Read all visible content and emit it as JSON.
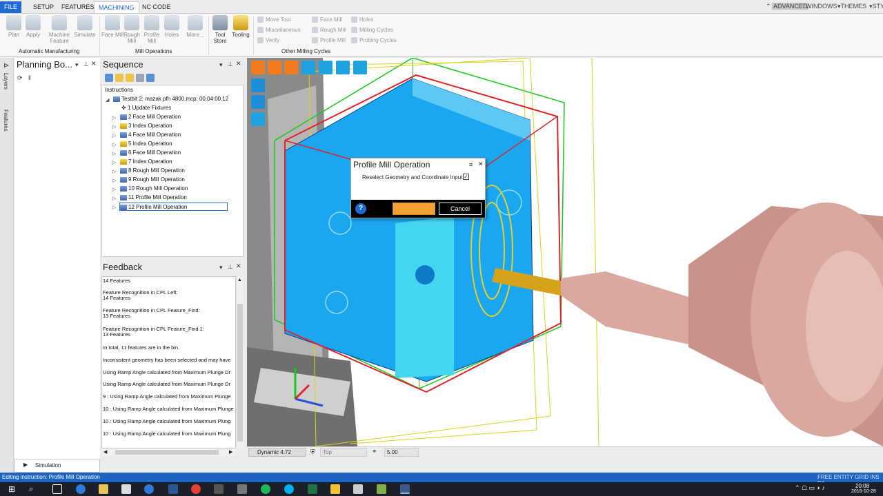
{
  "tabs": [
    "FILE",
    "SETUP",
    "FEATURES",
    "MACHINING",
    "NC CODE"
  ],
  "active_tab": "MACHINING",
  "right_tabs": [
    "ADVANCED",
    "WINDOWS",
    "THEMES",
    "STYL"
  ],
  "ribbon": {
    "buttons": [
      {
        "label": "Plan"
      },
      {
        "label": "Apply"
      },
      {
        "label": "Machine Feature"
      },
      {
        "label": "Simulate"
      },
      {
        "label": "Face Mill"
      },
      {
        "label": "Rough Mill"
      },
      {
        "label": "Profile Mill"
      },
      {
        "label": "Holes"
      },
      {
        "label": "More..."
      },
      {
        "label": "Tool Store"
      },
      {
        "label": "Tooling"
      }
    ],
    "small_col1": [
      "Move Tool",
      "Miscellaneous",
      "Verify"
    ],
    "small_col2": [
      "Face Mill",
      "Rough Mill",
      "Profile Mill"
    ],
    "small_col3": [
      "Holes",
      "Milling Cycles",
      "Probing Cycles"
    ],
    "groups": [
      "Automatic Manufacturing",
      "Mill Operations",
      "Other Milling Cycles"
    ]
  },
  "left_strip": [
    "Layers",
    "Features"
  ],
  "planning_panel": {
    "title": "Planning Bo..."
  },
  "sequence_panel": {
    "title": "Sequence",
    "header": "Instructions",
    "root": "Testbit 2: mazak pfh 4800.mcp: 00:04:00.12",
    "items": [
      "1 Update Fixtures",
      "2 Face Mill Operation",
      "3 Index Operation",
      "4 Face Mill Operation",
      "5 Index Operation",
      "6 Face Mill Operation",
      "7 Index Operation",
      "8 Rough Mill Operation",
      "9 Rough Mill Operation",
      "10 Rough Mill Operation",
      "11 Profile Mill Operation",
      "12 Profile Mill Operation"
    ],
    "selected": "12 Profile Mill Operation"
  },
  "feedback_panel": {
    "title": "Feedback",
    "lines": [
      "14 Features",
      "Feature Recognition in CPL Left:",
      " 14 Features",
      "Feature Recognition in CPL Feature_Find:",
      " 13 Features",
      "Feature Recognition in CPL Feature_Find.1:",
      " 13 Features",
      "In total,  11 features are in the bin.",
      "Inconsistent geometry has been selected and may have",
      "Using Ramp Angle calculated from Maximum Plunge Dr",
      "Using Ramp Angle calculated from Maximum Plunge Dr",
      "9 : Using Ramp Angle calculated from Maximum Plunge",
      "10 : Using Ramp Angle calculated from Maximum Plunge",
      "10 : Using Ramp Angle calculated from Maximum Plung",
      "10 : Using Ramp Angle calculated from Maximum Plung"
    ]
  },
  "simulation_label": "Simulation",
  "dialog": {
    "title": "Profile Mill Operation",
    "checkbox_label": "Reselect Geometry and Coordinate Input",
    "checked": true,
    "cancel_label": "Cancel",
    "help": "?"
  },
  "viewport_bar": {
    "mode": "Dynamic 4.72",
    "view": "Top",
    "zoom": "5.00"
  },
  "status_text": "Editing instruction: Profile Mill Operation",
  "status_right": "FREE ENTITY GRID INS RA",
  "clock": {
    "time": "20:08",
    "date": "2016-10-28"
  },
  "colors": {
    "accent": "#1e6bd6",
    "part": "#1aa7f0",
    "tool": "#d9a8a1",
    "ok": "#f5a035"
  }
}
